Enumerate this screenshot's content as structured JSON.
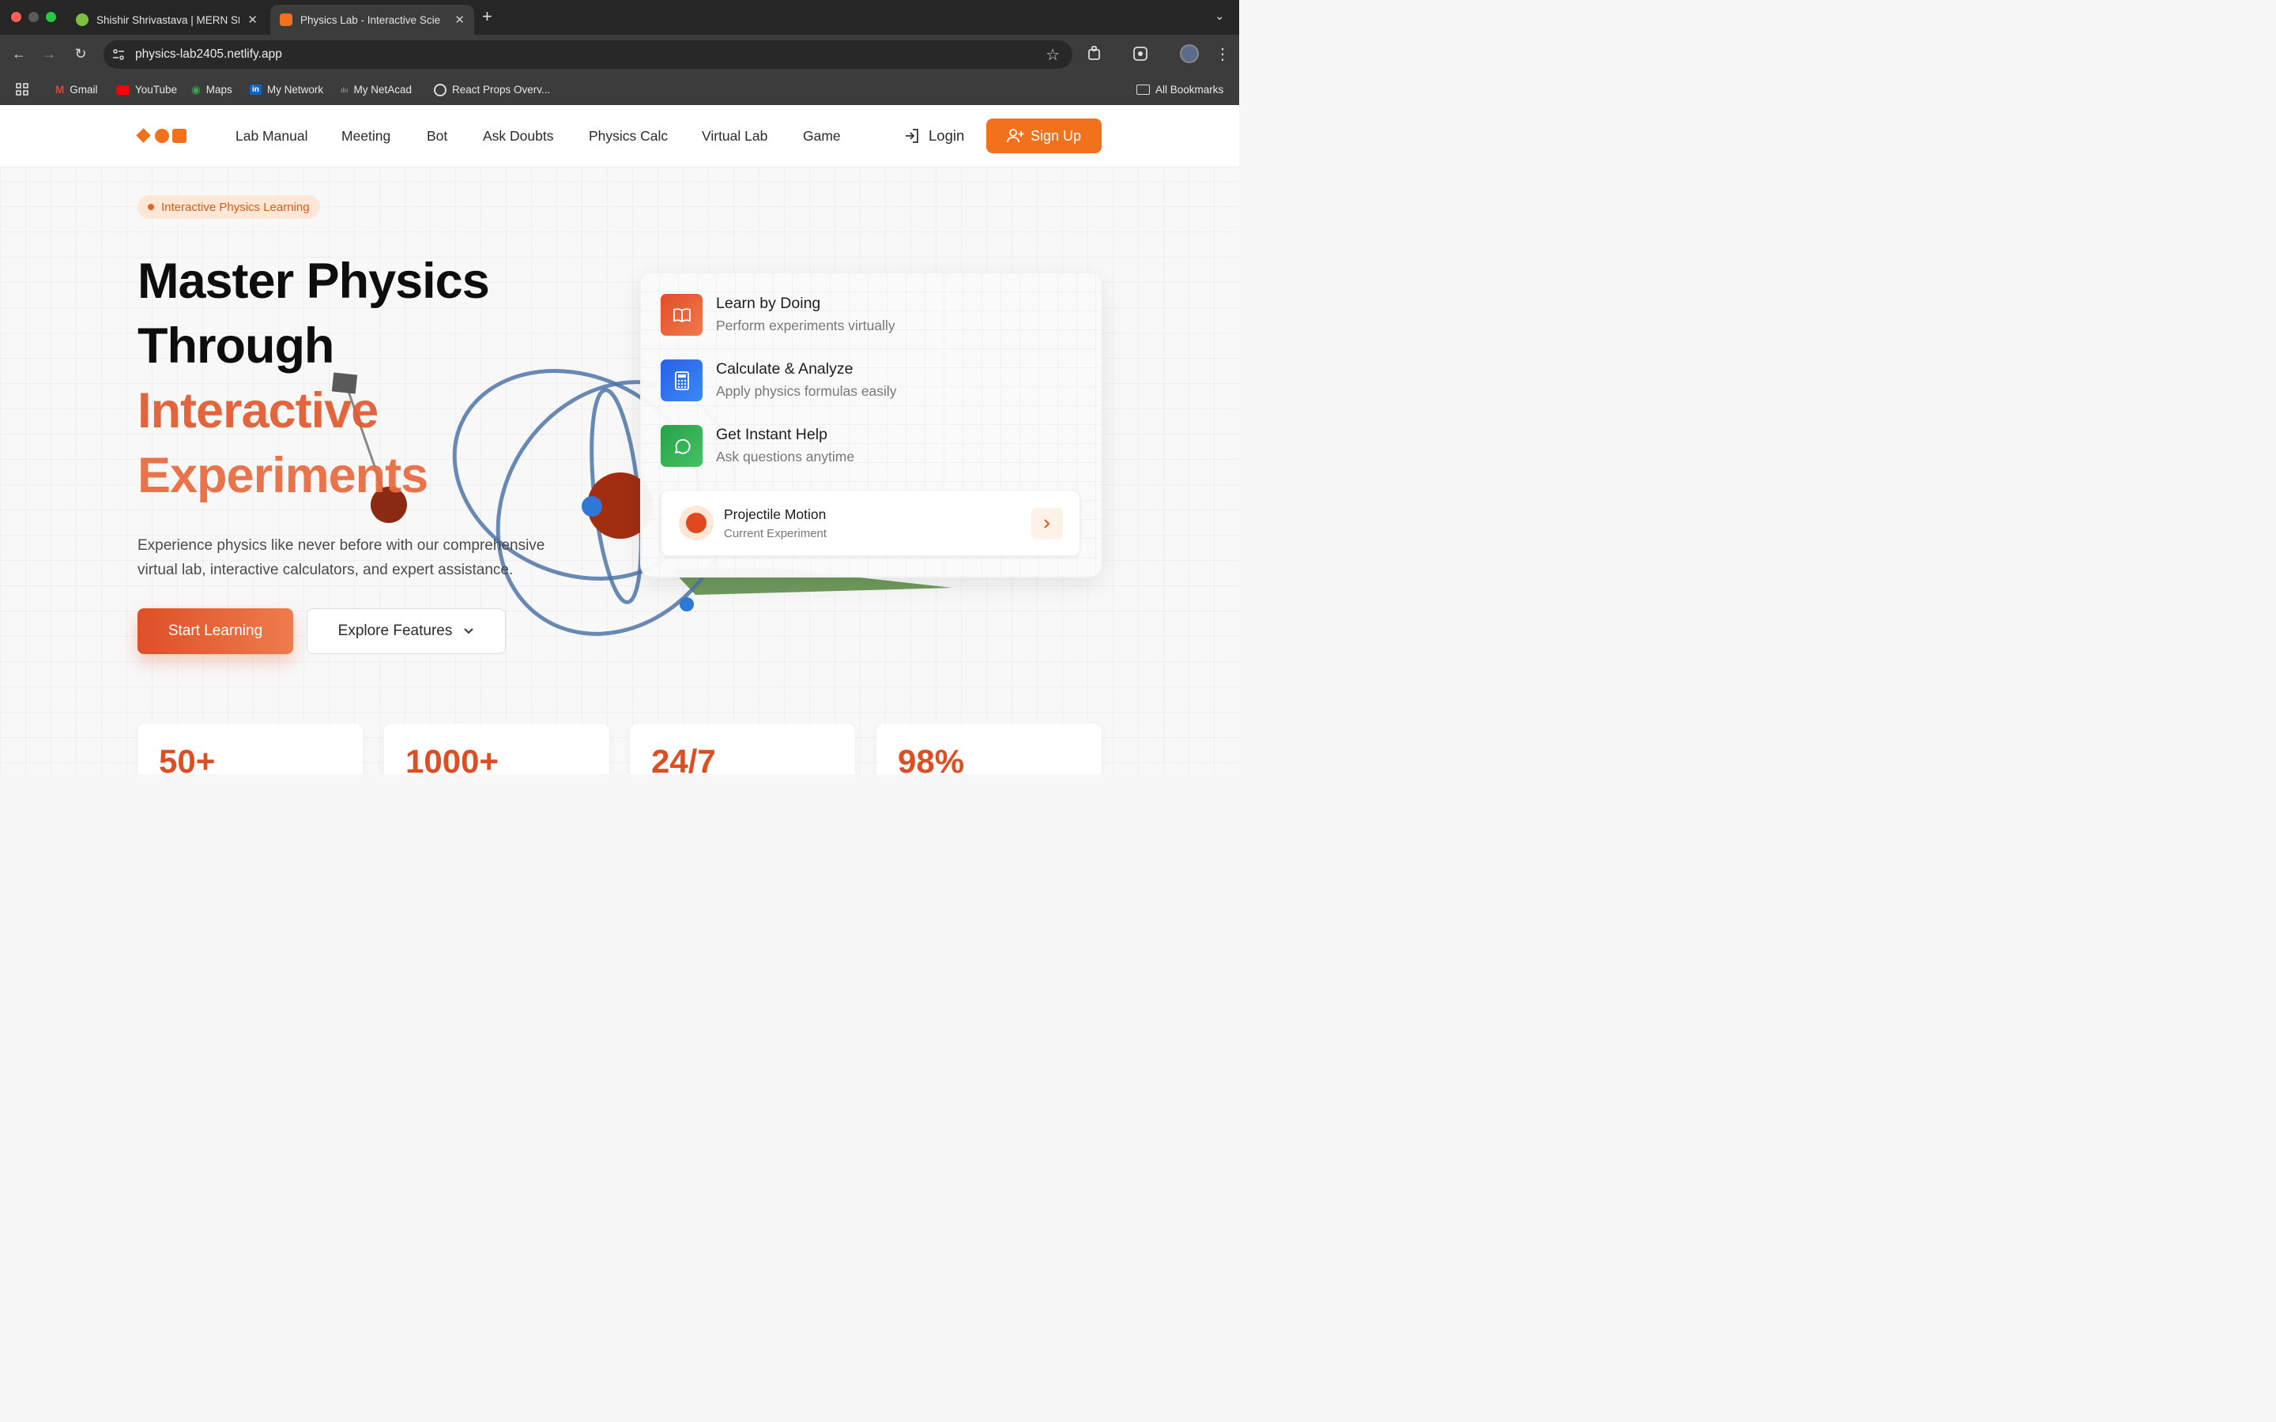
{
  "browser": {
    "tabs": [
      {
        "title": "Shishir Shrivastava | MERN St",
        "favicon_color": "#7cc242"
      },
      {
        "title": "Physics Lab - Interactive Scie",
        "favicon_color": "#f2711c",
        "active": true
      }
    ],
    "new_tab": "+",
    "url": "physics-lab2405.netlify.app",
    "bookmarks": [
      "Gmail",
      "YouTube",
      "Maps",
      "My Network",
      "My NetAcad",
      "React Props Overv..."
    ],
    "all_bookmarks": "All Bookmarks"
  },
  "nav": {
    "links": [
      "Lab Manual",
      "Meeting",
      "Bot",
      "Ask Doubts",
      "Physics Calc",
      "Virtual Lab",
      "Game"
    ],
    "login": "Login",
    "signup": "Sign Up"
  },
  "hero": {
    "badge": "Interactive Physics Learning",
    "title_line1": "Master Physics",
    "title_line2": "Through",
    "title_line3": "Interactive",
    "title_line4": "Experiments",
    "description": "Experience physics like never before with our comprehensive virtual lab, interactive calculators, and expert assistance.",
    "primary_button": "Start Learning",
    "secondary_button": "Explore Features"
  },
  "features": [
    {
      "title": "Learn by Doing",
      "subtitle": "Perform experiments virtually",
      "icon": "book-icon",
      "color": "#e4532a"
    },
    {
      "title": "Calculate & Analyze",
      "subtitle": "Apply physics formulas easily",
      "icon": "calculator-icon",
      "color": "#2f6ef0"
    },
    {
      "title": "Get Instant Help",
      "subtitle": "Ask questions anytime",
      "icon": "chat-icon",
      "color": "#2fa84f"
    }
  ],
  "current_experiment": {
    "title": "Projectile Motion",
    "label": "Current Experiment"
  },
  "stats": [
    "50+",
    "1000+",
    "24/7",
    "98%"
  ],
  "colors": {
    "accent": "#f2711c",
    "accent_dark": "#dc4f25",
    "chrome": "#3c3c3c"
  }
}
